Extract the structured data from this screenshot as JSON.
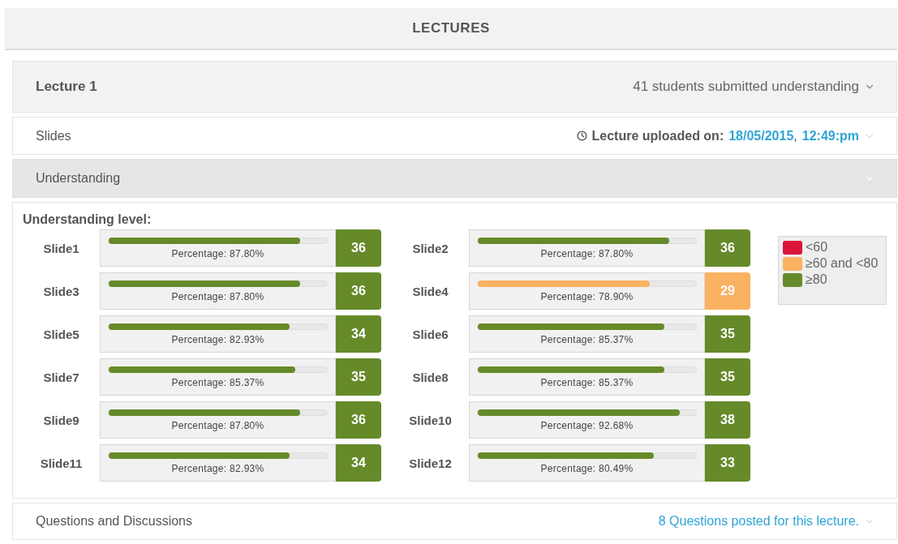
{
  "page_title": "LECTURES",
  "lecture": {
    "title": "Lecture 1",
    "summary": "41 students submitted understanding"
  },
  "slides_section": {
    "title": "Slides",
    "uploaded_label": "Lecture uploaded on:",
    "date": "18/05/2015",
    "separator": ",",
    "time": "12:49:pm"
  },
  "understanding_section": {
    "title": "Understanding",
    "heading": "Understanding level:",
    "slides": [
      {
        "name": "Slide1",
        "level": 0.878,
        "percentage": "Percentage: 87.80%",
        "count": "36",
        "color": "#668a2a"
      },
      {
        "name": "Slide2",
        "level": 0.878,
        "percentage": "Percentage: 87.80%",
        "count": "36",
        "color": "#668a2a"
      },
      {
        "name": "Slide3",
        "level": 0.878,
        "percentage": "Percentage: 87.80%",
        "count": "36",
        "color": "#668a2a"
      },
      {
        "name": "Slide4",
        "level": 0.789,
        "percentage": "Percentage: 78.90%",
        "count": "29",
        "color": "#fbb162"
      },
      {
        "name": "Slide5",
        "level": 0.8293,
        "percentage": "Percentage: 82.93%",
        "count": "34",
        "color": "#668a2a"
      },
      {
        "name": "Slide6",
        "level": 0.8537,
        "percentage": "Percentage: 85.37%",
        "count": "35",
        "color": "#668a2a"
      },
      {
        "name": "Slide7",
        "level": 0.8537,
        "percentage": "Percentage: 85.37%",
        "count": "35",
        "color": "#668a2a"
      },
      {
        "name": "Slide8",
        "level": 0.8537,
        "percentage": "Percentage: 85.37%",
        "count": "35",
        "color": "#668a2a"
      },
      {
        "name": "Slide9",
        "level": 0.878,
        "percentage": "Percentage: 87.80%",
        "count": "36",
        "color": "#668a2a"
      },
      {
        "name": "Slide10",
        "level": 0.9268,
        "percentage": "Percentage: 92.68%",
        "count": "38",
        "color": "#668a2a"
      },
      {
        "name": "Slide11",
        "level": 0.8293,
        "percentage": "Percentage: 82.93%",
        "count": "34",
        "color": "#668a2a"
      },
      {
        "name": "Slide12",
        "level": 0.8049,
        "percentage": "Percentage: 80.49%",
        "count": "33",
        "color": "#668a2a"
      }
    ],
    "legend": [
      {
        "label": "<60",
        "color": "#dc143c"
      },
      {
        "label": "≥60 and <80",
        "color": "#fbb162"
      },
      {
        "label": "≥80",
        "color": "#668a2a"
      }
    ]
  },
  "questions_section": {
    "title": "Questions and Discussions",
    "summary": "8 Questions posted for this lecture."
  }
}
